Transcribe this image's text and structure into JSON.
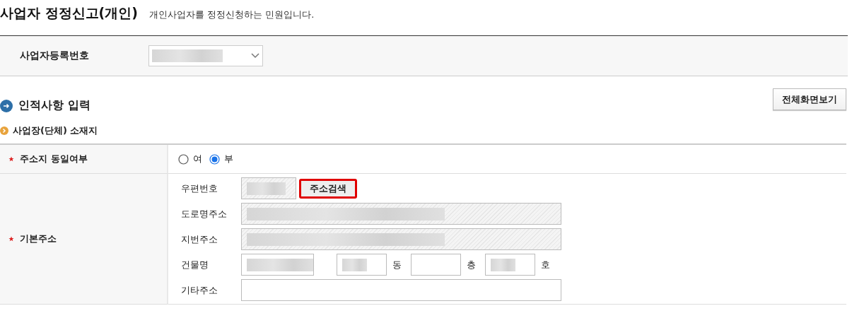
{
  "page": {
    "title": "사업자 정정신고(개인)",
    "description": "개인사업자를 정정신청하는 민원입니다."
  },
  "business_number": {
    "label": "사업자등록번호",
    "redacted": true
  },
  "section": {
    "title": "인적사항 입력",
    "fullscreen_button": "전체화면보기"
  },
  "subsection": {
    "title": "사업장(단체) 소재지"
  },
  "form": [
    {
      "kind": "radio",
      "label": "주소지 동일여부",
      "required": true,
      "options": [
        {
          "label": "여",
          "selected": false
        },
        {
          "label": "부",
          "selected": true
        }
      ]
    },
    {
      "kind": "address",
      "label": "기본주소",
      "required": true,
      "lines": [
        {
          "label": "우편번호",
          "fields": [
            {
              "kind": "zip",
              "readonly": true,
              "redacted": true
            }
          ],
          "button": {
            "label": "주소검색",
            "highlighted": true
          }
        },
        {
          "label": "도로명주소",
          "fields": [
            {
              "kind": "full",
              "readonly": true,
              "redacted": true
            }
          ]
        },
        {
          "label": "지번주소",
          "fields": [
            {
              "kind": "full",
              "readonly": true,
              "redacted": true
            }
          ]
        },
        {
          "label": "건물명",
          "fields": [
            {
              "kind": "name",
              "readonly": false,
              "redacted": true
            },
            {
              "kind": "unit",
              "readonly": false,
              "redacted": true,
              "suffix": "동"
            },
            {
              "kind": "unit",
              "readonly": false,
              "redacted": false,
              "suffix": "층"
            },
            {
              "kind": "unit",
              "readonly": false,
              "redacted": true,
              "suffix": "호"
            }
          ]
        },
        {
          "label": "기타주소",
          "fields": [
            {
              "kind": "full",
              "readonly": false,
              "redacted": false
            }
          ]
        }
      ]
    }
  ]
}
